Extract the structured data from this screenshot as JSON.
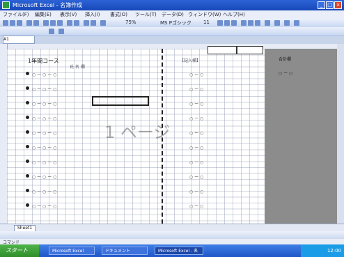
{
  "window": {
    "title": "Microsoft Excel - 名簿作成",
    "min": "_",
    "max": "□",
    "close": "×"
  },
  "menu": [
    "ファイル(F)",
    "編集(E)",
    "表示(V)",
    "挿入(I)",
    "書式(O)",
    "ツール(T)",
    "データ(D)",
    "ウィンドウ(W)",
    "ヘルプ(H)"
  ],
  "toolbar": {
    "font": "MS Pゴシック",
    "size": "11",
    "zoom": "75%"
  },
  "namebox": "A1",
  "sheet": {
    "header_title": "1年間コース",
    "header_sub": "氏  名  欄",
    "section_label": "【記入欄】",
    "page_watermark": "1 ページ",
    "rows": [
      {
        "text": "○ ー ○ ー ○",
        "right": "○ ー ○"
      },
      {
        "text": "○ ー ○ ー ○",
        "right": "○ ー ○"
      },
      {
        "text": "○ ー ○ ー ○",
        "right": "○ ー ○"
      },
      {
        "text": "○ ー ○ ー ○",
        "right": "○ ー ○"
      },
      {
        "text": "○ ー ○ ー ○",
        "right": "○ ー ○"
      },
      {
        "text": "○ ー ○ ー ○",
        "right": "○ ー ○"
      },
      {
        "text": "○ ー ○ ー ○",
        "right": "○ ー ○"
      },
      {
        "text": "○ ー ○ ー ○",
        "right": "○ ー ○"
      },
      {
        "text": "○ ー ○ ー ○",
        "right": "○ ー ○"
      },
      {
        "text": "○ ー ○ ー ○",
        "right": "○ ー ○"
      }
    ],
    "grey_notes": [
      "合計欄",
      "○ ー ○"
    ]
  },
  "sheet_tab": "Sheet1",
  "status": "コマンド",
  "taskbar": {
    "start": "スタート",
    "tasks": [
      "Microsoft Excel",
      "ドキュメント",
      "Microsoft Excel - 名"
    ],
    "clock": "12:00"
  }
}
